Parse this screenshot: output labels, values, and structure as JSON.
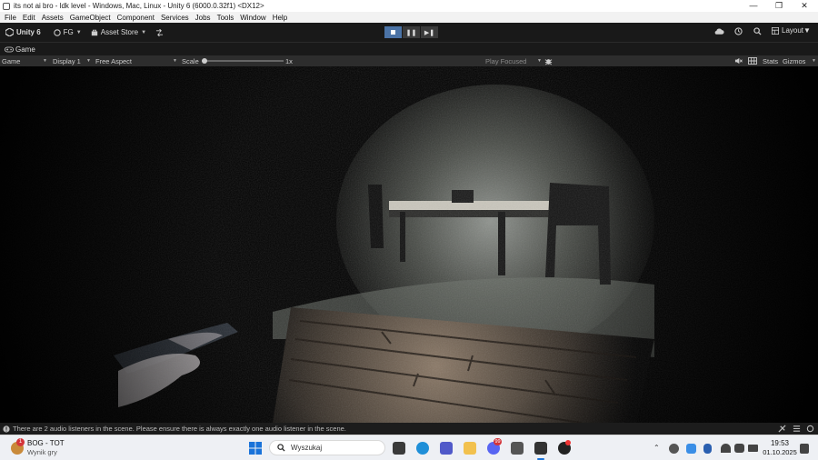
{
  "window": {
    "title": "its not ai bro - ldk level - Windows, Mac, Linux - Unity 6 (6000.0.32f1) <DX12>"
  },
  "menu": [
    "File",
    "Edit",
    "Assets",
    "GameObject",
    "Component",
    "Services",
    "Jobs",
    "Tools",
    "Window",
    "Help"
  ],
  "toolbar": {
    "unity_label": "Unity 6",
    "account_label": "FG",
    "asset_store_label": "Asset Store",
    "layout_label": "Layout"
  },
  "tab": {
    "game_label": "Game"
  },
  "gamebar": {
    "view_label": "Game",
    "display_label": "Display 1",
    "aspect_label": "Free Aspect",
    "scale_label": "Scale",
    "scale_value": "1x",
    "play_focused_label": "Play Focused",
    "stats_label": "Stats",
    "gizmos_label": "Gizmos",
    "scale_fraction": 0
  },
  "status": {
    "message": "There are 2 audio listeners in the scene. Please ensure there is always exactly one audio listener in the scene."
  },
  "taskbar": {
    "media_title": "BOG - TOT",
    "media_subtitle": "Wynik gry",
    "media_badge": "1",
    "search_placeholder": "Wyszukaj",
    "discord_badge": "99",
    "time": "19:53",
    "date": "01.10.2025"
  },
  "colors": {
    "accent_play": "#4b73a6",
    "toolbar_bg": "#191919",
    "taskbar_bg": "#eef0f4"
  }
}
